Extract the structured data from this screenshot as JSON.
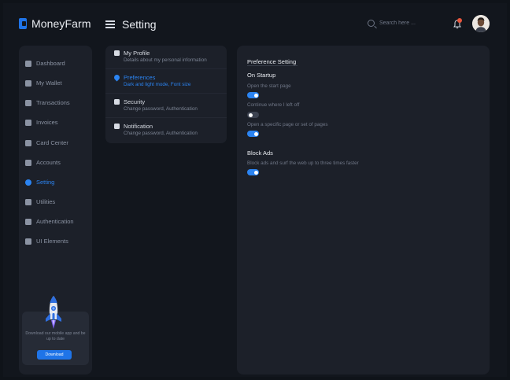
{
  "app": {
    "name": "MoneyFarm"
  },
  "header": {
    "title": "Setting",
    "search_placeholder": "Search here ..."
  },
  "sidebar": {
    "items": [
      {
        "label": "Dashboard",
        "icon": "dashboard-icon",
        "active": false
      },
      {
        "label": "My Wallet",
        "icon": "wallet-icon",
        "active": false
      },
      {
        "label": "Transactions",
        "icon": "transactions-icon",
        "active": false
      },
      {
        "label": "Invoices",
        "icon": "invoice-icon",
        "active": false
      },
      {
        "label": "Card Center",
        "icon": "card-icon",
        "active": false
      },
      {
        "label": "Accounts",
        "icon": "user-icon",
        "active": false
      },
      {
        "label": "Setting",
        "icon": "gear-icon",
        "active": true
      },
      {
        "label": "Utilities",
        "icon": "utilities-icon",
        "active": false
      },
      {
        "label": "Authentication",
        "icon": "lock-icon",
        "active": false
      },
      {
        "label": "UI Elements",
        "icon": "elements-icon",
        "active": false
      }
    ],
    "promo": {
      "text": "Download our mobile app and be up to date",
      "button_label": "Download"
    }
  },
  "settings_menu": {
    "items": [
      {
        "title": "My Profile",
        "subtitle": "Details about my personal information",
        "icon": "user-icon",
        "active": false
      },
      {
        "title": "Preferences",
        "subtitle": "Dark and light mode, Font size",
        "icon": "heart-icon",
        "active": true
      },
      {
        "title": "Security",
        "subtitle": "Change password, Authentication",
        "icon": "lock-icon",
        "active": false
      },
      {
        "title": "Notification",
        "subtitle": "Change password, Authentication",
        "icon": "bell-icon",
        "active": false
      }
    ]
  },
  "preferences": {
    "title": "Preference Setting",
    "startup": {
      "title": "On Startup",
      "options": [
        {
          "label": "Open the start page",
          "enabled": true
        },
        {
          "label": "Continue where I left off",
          "enabled": false
        },
        {
          "label": "Open a specific page or set of pages",
          "enabled": true
        }
      ]
    },
    "block_ads": {
      "title": "Block Ads",
      "options": [
        {
          "label": "Block ads and surf the web up to three times faster",
          "enabled": true
        }
      ]
    }
  },
  "colors": {
    "background": "#12161d",
    "card": "#1c2029",
    "accent": "#2b84f2",
    "muted_text": "#8b93a3",
    "notification_dot": "#e8563d"
  }
}
